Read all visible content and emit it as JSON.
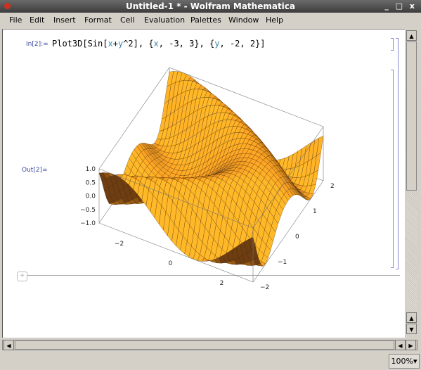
{
  "window": {
    "title": "Untitled-1 * - Wolfram Mathematica",
    "controls": "_ □ x"
  },
  "menu": [
    "File",
    "Edit",
    "Insert",
    "Format",
    "Cell",
    "Evaluation",
    "Palettes",
    "Window",
    "Help"
  ],
  "cells": {
    "in_label": "In[2]:=",
    "out_label": "Out[2]=",
    "input_parts": [
      "Plot3D[Sin[",
      "x",
      "+",
      "y",
      "^2], {",
      "x",
      ", -3, 3}, {",
      "y",
      ", -2, 2}]"
    ]
  },
  "status": {
    "zoom": "100%"
  },
  "chart_data": {
    "type": "surface",
    "function": "Sin[x+y^2]",
    "xlim": [
      -3,
      3
    ],
    "ylim": [
      -2,
      2
    ],
    "zlim": [
      -1,
      1
    ],
    "x_ticks": [
      "-2",
      "0",
      "2"
    ],
    "y_ticks": [
      "-2",
      "-1",
      "0",
      "1",
      "2"
    ],
    "z_ticks": [
      "1.0",
      "0.5",
      "0.0",
      "-0.5",
      "-1.0"
    ],
    "mesh": true,
    "colors": {
      "surface": "#f0a020",
      "dark": "#6a3a10"
    }
  }
}
